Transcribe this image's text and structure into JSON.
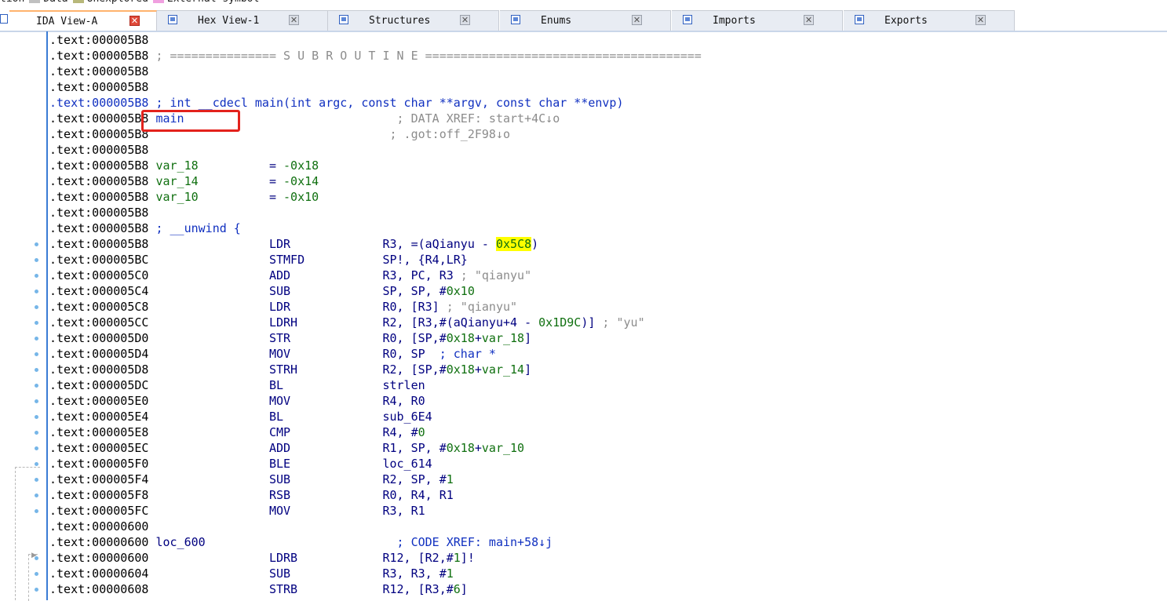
{
  "legend": [
    {
      "label": "tion",
      "color": ""
    },
    {
      "label": "Data",
      "color": "#c0c0c0"
    },
    {
      "label": "Unexplored",
      "color": "#b8b87a"
    },
    {
      "label": "External symbol",
      "color": "#f0a0e0"
    }
  ],
  "tabs": [
    {
      "label": "IDA View-A",
      "active": true
    },
    {
      "label": "Hex View-1",
      "active": false
    },
    {
      "label": "Structures",
      "active": false
    },
    {
      "label": "Enums",
      "active": false
    },
    {
      "label": "Imports",
      "active": false
    },
    {
      "label": "Exports",
      "active": false
    }
  ],
  "tab_close_glyph": "✕",
  "lines": [
    {
      "addr": ".text:000005B8",
      "segs": []
    },
    {
      "addr": ".text:000005B8",
      "segs": [
        {
          "t": " ; =============== S U B R O U T I N E =======================================",
          "c": "gray"
        }
      ]
    },
    {
      "addr": ".text:000005B8",
      "segs": []
    },
    {
      "addr": ".text:000005B8",
      "segs": []
    },
    {
      "addr": ".text:000005B8",
      "addr_blue": true,
      "segs": [
        {
          "t": " ; int __cdecl main(int argc, const char **argv, const char **envp)",
          "c": "blue"
        }
      ]
    },
    {
      "addr": ".text:000005B8",
      "segs": [
        {
          "t": " main",
          "c": "blue"
        },
        {
          "t": "                              ; DATA XREF: start+4C↓o",
          "c": "gray"
        }
      ]
    },
    {
      "addr": ".text:000005B8",
      "segs": [
        {
          "t": "                                  ; .got:off_2F98↓o",
          "c": "gray"
        }
      ]
    },
    {
      "addr": ".text:000005B8",
      "segs": []
    },
    {
      "addr": ".text:000005B8",
      "segs": [
        {
          "t": " var_18",
          "c": "green"
        },
        {
          "t": "          = ",
          "c": "navy"
        },
        {
          "t": "-0x18",
          "c": "green"
        }
      ]
    },
    {
      "addr": ".text:000005B8",
      "segs": [
        {
          "t": " var_14",
          "c": "green"
        },
        {
          "t": "          = ",
          "c": "navy"
        },
        {
          "t": "-0x14",
          "c": "green"
        }
      ]
    },
    {
      "addr": ".text:000005B8",
      "segs": [
        {
          "t": " var_10",
          "c": "green"
        },
        {
          "t": "          = ",
          "c": "navy"
        },
        {
          "t": "-0x10",
          "c": "green"
        }
      ]
    },
    {
      "addr": ".text:000005B8",
      "segs": []
    },
    {
      "addr": ".text:000005B8",
      "segs": [
        {
          "t": " ; __unwind {",
          "c": "blue"
        }
      ]
    },
    {
      "addr": ".text:000005B8",
      "segs": [
        {
          "t": "                 LDR             R3, =(aQianyu - ",
          "c": "navy"
        },
        {
          "t": "0x5C8",
          "c": "green",
          "hl": true
        },
        {
          "t": ")",
          "c": "navy"
        }
      ]
    },
    {
      "addr": ".text:000005BC",
      "segs": [
        {
          "t": "                 STMFD           SP!, {R4,LR}",
          "c": "navy"
        }
      ]
    },
    {
      "addr": ".text:000005C0",
      "segs": [
        {
          "t": "                 ADD             R3, PC, R3",
          "c": "navy"
        },
        {
          "t": " ; \"qianyu\"",
          "c": "gray"
        }
      ]
    },
    {
      "addr": ".text:000005C4",
      "segs": [
        {
          "t": "                 SUB             SP, SP, #",
          "c": "navy"
        },
        {
          "t": "0x10",
          "c": "green"
        }
      ]
    },
    {
      "addr": ".text:000005C8",
      "segs": [
        {
          "t": "                 LDR             R0, [R3]",
          "c": "navy"
        },
        {
          "t": " ; \"qianyu\"",
          "c": "gray"
        }
      ]
    },
    {
      "addr": ".text:000005CC",
      "segs": [
        {
          "t": "                 LDRH            R2, [R3,#(aQianyu+4 - ",
          "c": "navy"
        },
        {
          "t": "0x1D9C",
          "c": "green"
        },
        {
          "t": ")]",
          "c": "navy"
        },
        {
          "t": " ; \"yu\"",
          "c": "gray"
        }
      ]
    },
    {
      "addr": ".text:000005D0",
      "segs": [
        {
          "t": "                 STR             R0, [SP,#",
          "c": "navy"
        },
        {
          "t": "0x18",
          "c": "green"
        },
        {
          "t": "+",
          "c": "navy"
        },
        {
          "t": "var_18",
          "c": "green"
        },
        {
          "t": "]",
          "c": "navy"
        }
      ]
    },
    {
      "addr": ".text:000005D4",
      "segs": [
        {
          "t": "                 MOV             R0, SP",
          "c": "navy"
        },
        {
          "t": "  ; char *",
          "c": "blue"
        }
      ]
    },
    {
      "addr": ".text:000005D8",
      "segs": [
        {
          "t": "                 STRH            R2, [SP,#",
          "c": "navy"
        },
        {
          "t": "0x18",
          "c": "green"
        },
        {
          "t": "+",
          "c": "navy"
        },
        {
          "t": "var_14",
          "c": "green"
        },
        {
          "t": "]",
          "c": "navy"
        }
      ]
    },
    {
      "addr": ".text:000005DC",
      "segs": [
        {
          "t": "                 BL              strlen",
          "c": "navy"
        }
      ]
    },
    {
      "addr": ".text:000005E0",
      "segs": [
        {
          "t": "                 MOV             R4, R0",
          "c": "navy"
        }
      ]
    },
    {
      "addr": ".text:000005E4",
      "segs": [
        {
          "t": "                 BL              sub_6E4",
          "c": "navy"
        }
      ]
    },
    {
      "addr": ".text:000005E8",
      "segs": [
        {
          "t": "                 CMP             R4, #",
          "c": "navy"
        },
        {
          "t": "0",
          "c": "green"
        }
      ]
    },
    {
      "addr": ".text:000005EC",
      "segs": [
        {
          "t": "                 ADD             R1, SP, #",
          "c": "navy"
        },
        {
          "t": "0x18",
          "c": "green"
        },
        {
          "t": "+",
          "c": "navy"
        },
        {
          "t": "var_10",
          "c": "green"
        }
      ]
    },
    {
      "addr": ".text:000005F0",
      "segs": [
        {
          "t": "                 BLE             loc_614",
          "c": "navy"
        }
      ]
    },
    {
      "addr": ".text:000005F4",
      "segs": [
        {
          "t": "                 SUB             R2, SP, #",
          "c": "navy"
        },
        {
          "t": "1",
          "c": "green"
        }
      ]
    },
    {
      "addr": ".text:000005F8",
      "segs": [
        {
          "t": "                 RSB             R0, R4, R1",
          "c": "navy"
        }
      ]
    },
    {
      "addr": ".text:000005FC",
      "segs": [
        {
          "t": "                 MOV             R3, R1",
          "c": "navy"
        }
      ]
    },
    {
      "addr": ".text:00000600",
      "segs": []
    },
    {
      "addr": ".text:00000600",
      "segs": [
        {
          "t": " loc_600",
          "c": "navy"
        },
        {
          "t": "                           ; CODE XREF: main+58↓j",
          "c": "blue"
        }
      ]
    },
    {
      "addr": ".text:00000600",
      "segs": [
        {
          "t": "                 LDRB            R12, [R2,#",
          "c": "navy"
        },
        {
          "t": "1",
          "c": "green"
        },
        {
          "t": "]!",
          "c": "navy"
        }
      ]
    },
    {
      "addr": ".text:00000604",
      "segs": [
        {
          "t": "                 SUB             R3, R3, #",
          "c": "navy"
        },
        {
          "t": "1",
          "c": "green"
        }
      ]
    },
    {
      "addr": ".text:00000608",
      "segs": [
        {
          "t": "                 STRB            R12, [R3,#",
          "c": "navy"
        },
        {
          "t": "6",
          "c": "green"
        },
        {
          "t": "]",
          "c": "navy"
        }
      ]
    }
  ],
  "dot_lines": [
    13,
    14,
    15,
    16,
    17,
    18,
    19,
    20,
    21,
    22,
    23,
    24,
    25,
    26,
    27,
    28,
    29,
    30,
    33,
    34,
    35
  ],
  "highlight_box_label": "main"
}
